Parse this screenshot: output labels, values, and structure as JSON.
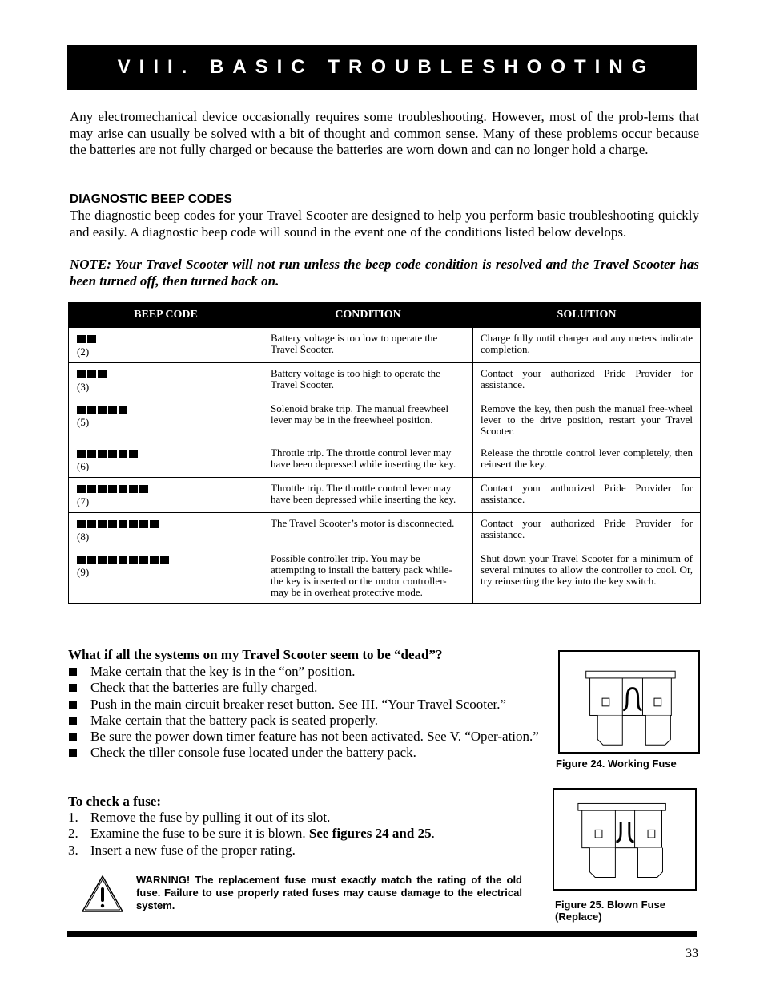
{
  "title": "VIII. BASIC TROUBLESHOOTING",
  "intro": "Any electromechanical device occasionally requires some troubleshooting. However, most of the prob-lems that may arise can usually be solved with a bit of thought and common sense. Many of these problems occur because the batteries are not fully charged or because the batteries are worn down and can no longer hold a charge.",
  "diagnostic": {
    "heading": "DIAGNOSTIC BEEP CODES",
    "body": "The diagnostic beep codes for your Travel Scooter are designed to help you perform basic troubleshooting quickly and easily. A diagnostic beep code will sound in the event one of the conditions listed below develops.",
    "note": "NOTE: Your Travel Scooter will not run unless the beep code condition is resolved and the Travel Scooter has been turned off, then turned back on."
  },
  "table": {
    "headers": [
      "BEEP CODE",
      "CONDITION",
      "SOLUTION"
    ],
    "rows": [
      {
        "beeps": 2,
        "label": "(2)",
        "condition": "Battery voltage is too low to operate the Travel Scooter.",
        "solution": "Charge fully until charger and any meters indicate completion."
      },
      {
        "beeps": 3,
        "label": "(3)",
        "condition": "Battery voltage is too high to operate the Travel Scooter.",
        "solution": "Contact your authorized Pride Provider for assistance."
      },
      {
        "beeps": 5,
        "label": "(5)",
        "condition": "Solenoid brake trip. The manual freewheel lever may be in the freewheel position.",
        "solution": "Remove the key, then push the manual free-wheel lever to the drive position, restart your Travel Scooter."
      },
      {
        "beeps": 6,
        "label": "(6)",
        "condition": "Throttle trip. The throttle control lever may have been depressed while inserting the key.",
        "solution": "Release the throttle control lever completely, then reinsert the key."
      },
      {
        "beeps": 7,
        "label": "(7)",
        "condition": "Throttle trip. The throttle control lever may have been depressed while inserting the key.",
        "solution": "Contact your authorized Pride Provider for assistance."
      },
      {
        "beeps": 8,
        "label": "(8)",
        "condition": "The Travel Scooter’s motor is disconnected.",
        "solution": "Contact your authorized Pride Provider for assistance."
      },
      {
        "beeps": 9,
        "label": "(9)",
        "condition": "Possible controller trip. You may be attempting to install the battery pack while- the key is inserted or the motor controller- may be in overheat protective mode.",
        "solution": "Shut down your Travel Scooter for a minimum of several minutes to allow the controller to cool. Or, try reinserting the key into the key switch."
      }
    ]
  },
  "dead_systems": {
    "heading": "What if all the systems on my Travel Scooter seem to be “dead”?",
    "items": [
      "Make certain that the key is in the “on” position.",
      "Check that the batteries are fully charged.",
      "Push in the main circuit breaker reset button. See III. “Your Travel Scooter.”",
      "Make certain that the battery pack is seated properly.",
      "Be sure the power down timer feature has not been activated. See V. “Oper-ation.”",
      "Check the tiller console fuse located under the battery pack."
    ]
  },
  "check_fuse": {
    "heading": "To check a fuse:",
    "steps": [
      {
        "num": "1.",
        "text": "Remove the fuse by pulling it out of its slot.",
        "bold": ""
      },
      {
        "num": "2.",
        "text": "Examine the fuse to be sure it is blown. ",
        "bold": "See figures 24 and 25",
        "after": "."
      },
      {
        "num": "3.",
        "text": "Insert a new fuse of the proper rating.",
        "bold": ""
      }
    ]
  },
  "warning": {
    "icon": "warning-triangle-icon",
    "text": "WARNING! The replacement fuse must exactly match the rating of the old fuse. Failure to use properly rated fuses may cause damage to the electrical system."
  },
  "figures": [
    {
      "caption": "Figure 24. Working Fuse",
      "state": "working"
    },
    {
      "caption": "Figure 25. Blown Fuse (Replace)",
      "state": "blown"
    }
  ],
  "page_number": "33"
}
